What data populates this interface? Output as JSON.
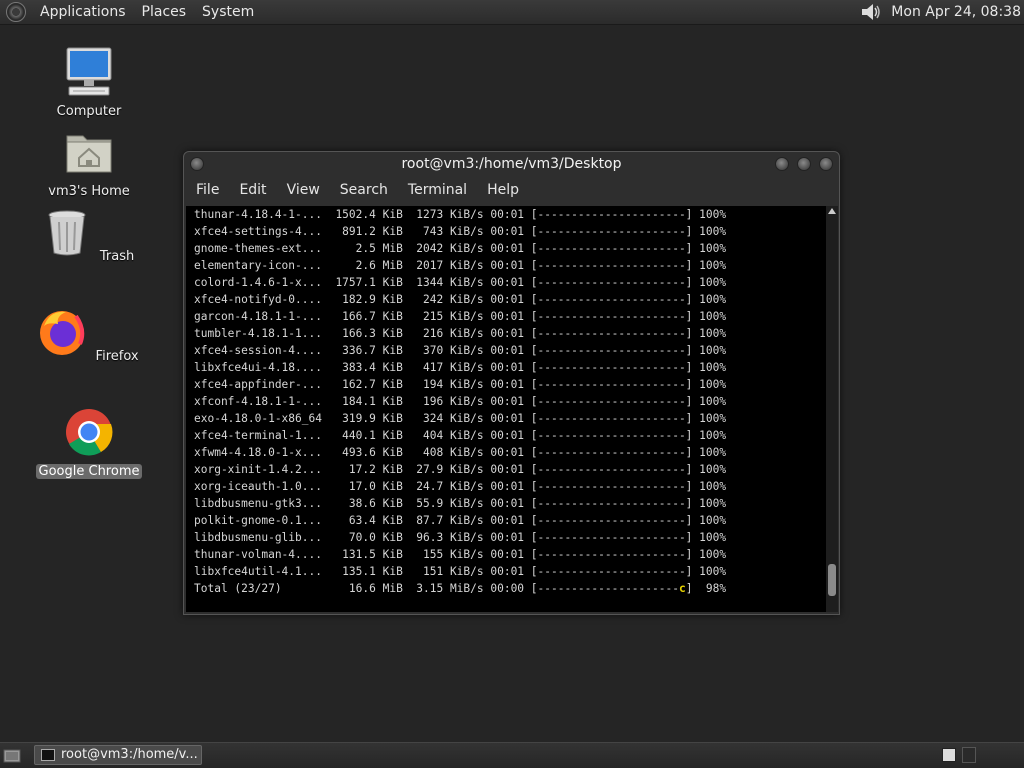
{
  "top_panel": {
    "menus": [
      "Applications",
      "Places",
      "System"
    ],
    "clock": "Mon Apr 24, 08:38"
  },
  "desktop_icons": [
    {
      "label": "Computer",
      "icon": "computer-icon"
    },
    {
      "label": "vm3's Home",
      "icon": "home-folder-icon"
    },
    {
      "label": "Trash",
      "icon": "trash-icon"
    },
    {
      "label": "Firefox",
      "icon": "firefox-icon"
    },
    {
      "label": "Google Chrome",
      "icon": "chrome-icon"
    }
  ],
  "terminal": {
    "title": "root@vm3:/home/vm3/Desktop",
    "menus": [
      "File",
      "Edit",
      "View",
      "Search",
      "Terminal",
      "Help"
    ],
    "lines": [
      "thunar-4.18.4-1-...  1502.4 KiB  1273 KiB/s 00:01 [----------------------] 100%",
      "xfce4-settings-4...   891.2 KiB   743 KiB/s 00:01 [----------------------] 100%",
      "gnome-themes-ext...     2.5 MiB  2042 KiB/s 00:01 [----------------------] 100%",
      "elementary-icon-...     2.6 MiB  2017 KiB/s 00:01 [----------------------] 100%",
      "colord-1.4.6-1-x...  1757.1 KiB  1344 KiB/s 00:01 [----------------------] 100%",
      "xfce4-notifyd-0....   182.9 KiB   242 KiB/s 00:01 [----------------------] 100%",
      "garcon-4.18.1-1-...   166.7 KiB   215 KiB/s 00:01 [----------------------] 100%",
      "tumbler-4.18.1-1...   166.3 KiB   216 KiB/s 00:01 [----------------------] 100%",
      "xfce4-session-4....   336.7 KiB   370 KiB/s 00:01 [----------------------] 100%",
      "libxfce4ui-4.18....   383.4 KiB   417 KiB/s 00:01 [----------------------] 100%",
      "xfce4-appfinder-...   162.7 KiB   194 KiB/s 00:01 [----------------------] 100%",
      "xfconf-4.18.1-1-...   184.1 KiB   196 KiB/s 00:01 [----------------------] 100%",
      "exo-4.18.0-1-x86_64   319.9 KiB   324 KiB/s 00:01 [----------------------] 100%",
      "xfce4-terminal-1...   440.1 KiB   404 KiB/s 00:01 [----------------------] 100%",
      "xfwm4-4.18.0-1-x...   493.6 KiB   408 KiB/s 00:01 [----------------------] 100%",
      "xorg-xinit-1.4.2...    17.2 KiB  27.9 KiB/s 00:01 [----------------------] 100%",
      "xorg-iceauth-1.0...    17.0 KiB  24.7 KiB/s 00:01 [----------------------] 100%",
      "libdbusmenu-gtk3...    38.6 KiB  55.9 KiB/s 00:01 [----------------------] 100%",
      "polkit-gnome-0.1...    63.4 KiB  87.7 KiB/s 00:01 [----------------------] 100%",
      "libdbusmenu-glib...    70.0 KiB  96.3 KiB/s 00:01 [----------------------] 100%",
      "thunar-volman-4....   131.5 KiB   155 KiB/s 00:01 [----------------------] 100%",
      "libxfce4util-4.1...   135.1 KiB   151 KiB/s 00:01 [----------------------] 100%"
    ],
    "total_line_prefix": "Total (23/27)          16.6 MiB  3.15 MiB/s 00:00 [---------------------",
    "total_line_pacman": "c",
    "total_line_suffix": "]  98%"
  },
  "taskbar": {
    "task_label": "root@vm3:/home/v..."
  }
}
